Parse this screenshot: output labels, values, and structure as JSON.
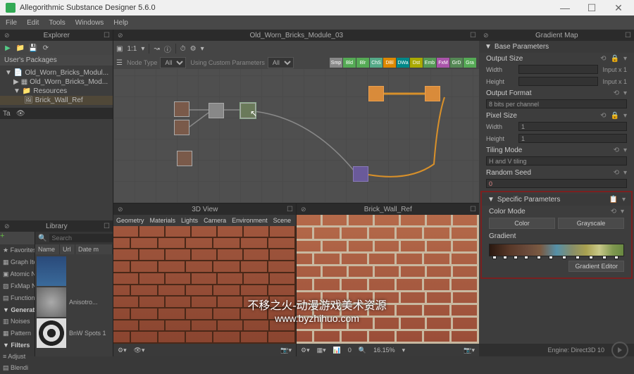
{
  "title": "Allegorithmic Substance Designer 5.6.0",
  "menubar": [
    "File",
    "Edit",
    "Tools",
    "Windows",
    "Help"
  ],
  "explorer": {
    "title": "Explorer",
    "section": "User's Packages",
    "items": [
      {
        "arrow": "▼",
        "icon": "📄",
        "label": "Old_Worn_Bricks_Modul...",
        "indent": 0
      },
      {
        "arrow": "▶",
        "icon": "▦",
        "label": "Old_Worn_Bricks_Mod...",
        "indent": 1
      },
      {
        "arrow": "▼",
        "icon": "📁",
        "label": "Resources",
        "indent": 1
      },
      {
        "arrow": "",
        "icon": "🖼",
        "label": "Brick_Wall_Ref",
        "indent": 2,
        "selected": true
      }
    ]
  },
  "library": {
    "title": "Library",
    "search_placeholder": "Search",
    "cols": [
      "Name",
      "Url",
      "Date m"
    ],
    "nav": [
      {
        "label": "Favorites",
        "icon": "★"
      },
      {
        "label": "Graph Item",
        "icon": "▦"
      },
      {
        "label": "Atomic No",
        "icon": "▣"
      },
      {
        "label": "FxMap No",
        "icon": "▨"
      },
      {
        "label": "Function N",
        "icon": "▤",
        "section": false
      },
      {
        "label": "Generators",
        "section": true
      },
      {
        "label": "Noises",
        "icon": "▥"
      },
      {
        "label": "Pattern",
        "icon": "▦"
      },
      {
        "label": "Filters",
        "section": true
      },
      {
        "label": "Adjust",
        "icon": "≡"
      },
      {
        "label": "Blendi",
        "icon": "▤"
      }
    ],
    "thumbs": [
      {
        "label": "",
        "class": "waves"
      },
      {
        "label": "Anisotro...",
        "class": "aniso"
      },
      {
        "label": "BnW Spots 1",
        "class": "bnw"
      }
    ]
  },
  "graph": {
    "title": "Old_Worn_Bricks_Module_03",
    "zoom": "1:1",
    "filter1_label": "Node Type",
    "filter1_value": "All",
    "filter2_label": "Using Custom Parameters",
    "filter2_value": "All",
    "chips": [
      {
        "t": "Smp",
        "c": "#888"
      },
      {
        "t": "Bld",
        "c": "#5a5"
      },
      {
        "t": "Blr",
        "c": "#5a5"
      },
      {
        "t": "ChS",
        "c": "#5a8"
      },
      {
        "t": "DBl",
        "c": "#d80"
      },
      {
        "t": "DWa",
        "c": "#088"
      },
      {
        "t": "Dst",
        "c": "#aa0"
      },
      {
        "t": "Emb",
        "c": "#595"
      },
      {
        "t": "FxM",
        "c": "#a5a"
      },
      {
        "t": "GrD",
        "c": "#585"
      },
      {
        "t": "Gra",
        "c": "#5a5"
      }
    ]
  },
  "view3d": {
    "title": "3D View",
    "tabs": [
      "Geometry",
      "Materials",
      "Lights",
      "Camera",
      "Environment",
      "Scene"
    ]
  },
  "view2d": {
    "title": "Brick_Wall_Ref",
    "zoom": "16.15%",
    "mip": "0"
  },
  "props": {
    "title": "Gradient Map",
    "sections": {
      "base": "Base Parameters",
      "specific": "Specific Parameters"
    },
    "output_size": "Output Size",
    "width": "Width",
    "height": "Height",
    "input_x1": "Input x 1",
    "output_format": "Output Format",
    "output_format_val": "8 bits per channel",
    "pixel_size": "Pixel Size",
    "pixel_val": "1",
    "tiling_mode": "Tiling Mode",
    "tiling_val": "H and V tiling",
    "random_seed": "Random Seed",
    "seed_val": "0",
    "color_mode": "Color Mode",
    "color_btn": "Color",
    "grayscale_btn": "Grayscale",
    "gradient": "Gradient",
    "gradient_editor": "Gradient Editor"
  },
  "status": {
    "engine": "Engine: Direct3D 10"
  },
  "watermark": {
    "l1": "不移之火-动漫游戏美术资源",
    "l2": "www.byzhihuo.com"
  }
}
